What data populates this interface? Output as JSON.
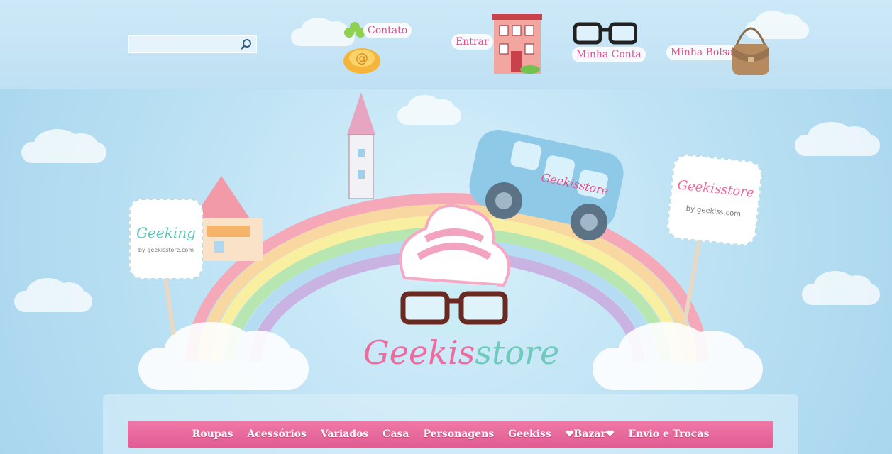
{
  "search": {
    "placeholder": ""
  },
  "header": {
    "contato": "Contato",
    "entrar": "Entrar",
    "minha_conta": "Minha Conta",
    "minha_bolsa": "Minha Bolsa"
  },
  "signs": {
    "left_sign": "Geeking",
    "left_sign_sub": "by geekisstore.com",
    "right_sign": "Geekisstore",
    "right_sign_sub": "by geekiss.com",
    "bus_label": "Geekisstore"
  },
  "logo": {
    "text_part1": "Geekis",
    "text_part2": "store"
  },
  "nav": {
    "items": [
      "Roupas",
      "Acessórios",
      "Variados",
      "Casa",
      "Personagens",
      "Geekiss",
      "❤Bazar❤",
      "Envio e Trocas"
    ]
  },
  "colors": {
    "pink": "#e0508a",
    "sky": "#bfe3f5",
    "mint": "#7fd3c4"
  }
}
